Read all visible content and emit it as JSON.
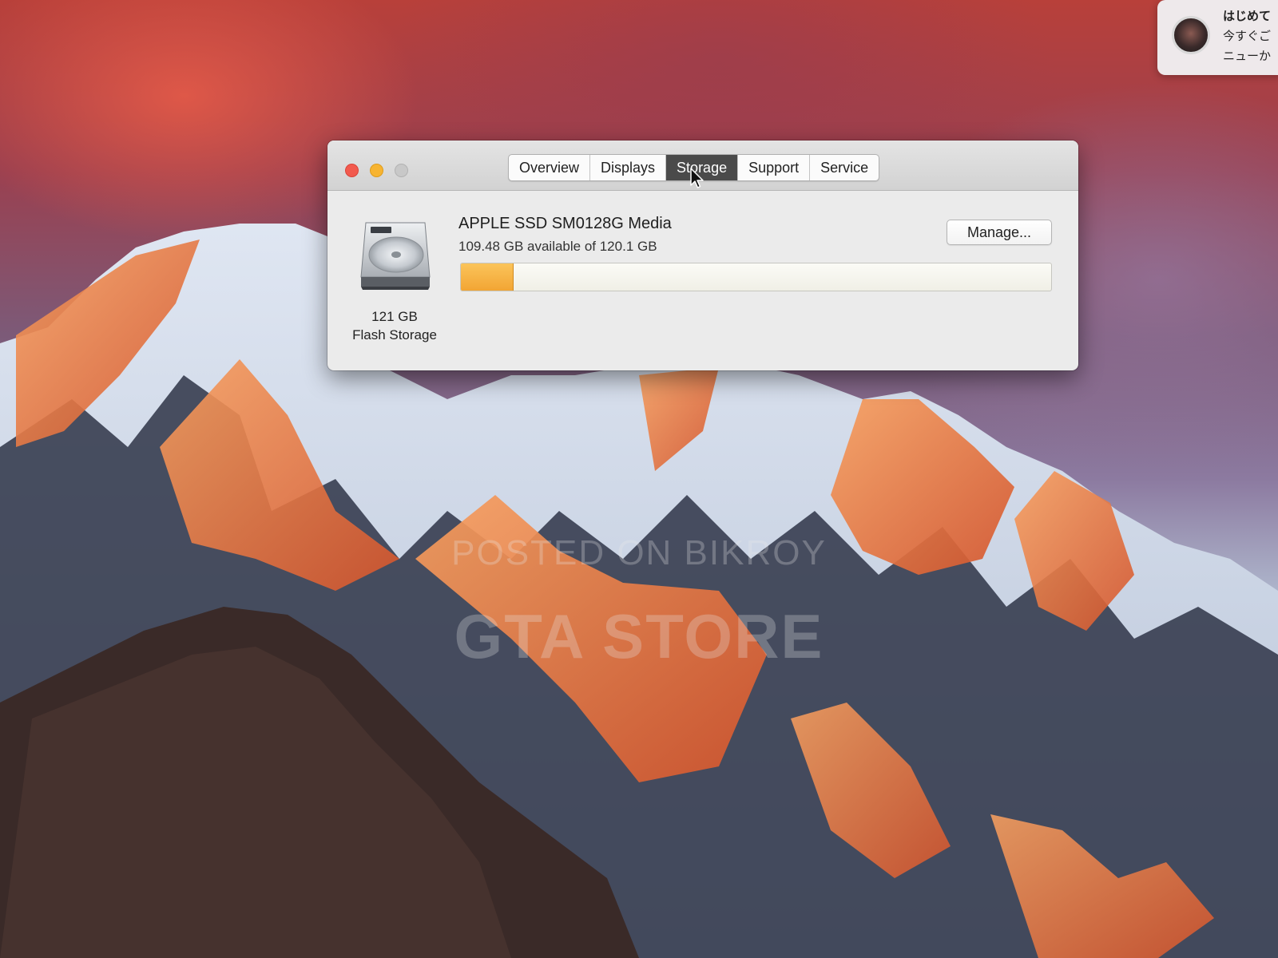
{
  "window": {
    "tabs": [
      {
        "label": "Overview",
        "active": false
      },
      {
        "label": "Displays",
        "active": false
      },
      {
        "label": "Storage",
        "active": true
      },
      {
        "label": "Support",
        "active": false
      },
      {
        "label": "Service",
        "active": false
      }
    ],
    "active_tab": "Storage"
  },
  "storage": {
    "drive_name": "APPLE SSD SM0128G Media",
    "availability": "109.48 GB available of 120.1 GB",
    "capacity_line1": "121 GB",
    "capacity_line2": "Flash Storage",
    "manage_label": "Manage...",
    "used_fraction": 0.088,
    "used_color": "#f5ad3c",
    "icon": "hard-drive-icon"
  },
  "notification": {
    "lines": [
      "はじめて",
      "今すぐご",
      "ニューか"
    ]
  },
  "watermark": {
    "line1": "POSTED ON BIKROY",
    "line2": "GTA STORE"
  }
}
